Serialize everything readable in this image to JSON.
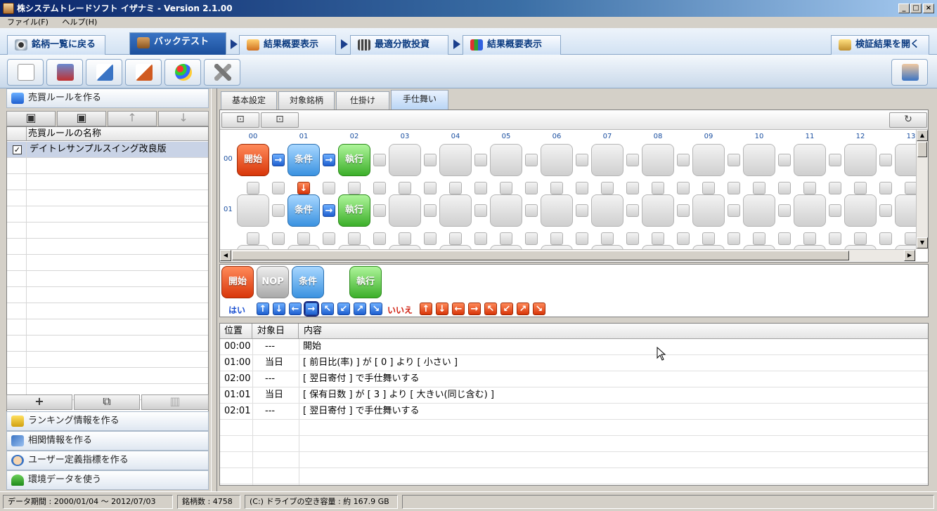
{
  "window": {
    "title": "株システムトレードソフト イザナミ - Version 2.1.00"
  },
  "menu": {
    "items": [
      "ファイル(F)",
      "ヘルプ(H)"
    ]
  },
  "main_tabs": {
    "stock_list": "銘柄一覧に戻る",
    "backtest": "バックテスト",
    "result_summary_1": "結果概要表示",
    "optimal_investment": "最適分散投資",
    "result_summary_2": "結果概要表示",
    "open_results": "検証結果を開く"
  },
  "left": {
    "rule_header": "売買ルールを作る",
    "list_column": "売買ルールの名称",
    "rules": [
      {
        "name": "デイトレサンプルスイング改良版",
        "checked": true
      }
    ],
    "ranking": "ランキング情報を作る",
    "correlation": "相関情報を作る",
    "user_indicator": "ユーザー定義指標を作る",
    "environment": "環境データを使う"
  },
  "sub_tabs": [
    "基本設定",
    "対象銘柄",
    "仕掛け",
    "手仕舞い"
  ],
  "flow": {
    "columns": [
      "00",
      "01",
      "02",
      "03",
      "04",
      "05",
      "06",
      "07",
      "08",
      "09",
      "10",
      "11",
      "12",
      "13"
    ],
    "rows": [
      "00",
      "01"
    ],
    "nodes": {
      "start": "開始",
      "cond": "条件",
      "exec": "執行"
    }
  },
  "palette": {
    "start": "開始",
    "nop": "NOP",
    "cond": "条件",
    "exec": "執行",
    "yes": "はい",
    "no": "いいえ"
  },
  "result_table": {
    "headers": [
      "位置",
      "対象日",
      "内容"
    ],
    "rows": [
      [
        "00:00",
        "---",
        "開始"
      ],
      [
        "01:00",
        "当日",
        "[ 前日比(率) ] が [ 0 ] より [ 小さい ]"
      ],
      [
        "02:00",
        "---",
        "[ 翌日寄付 ] で手仕舞いする"
      ],
      [
        "01:01",
        "当日",
        "[ 保有日数 ] が [ 3 ] より [ 大きい(同じ含む) ]"
      ],
      [
        "02:01",
        "---",
        "[ 翌日寄付 ] で手仕舞いする"
      ]
    ]
  },
  "status": {
    "period": "データ期間 : 2000/01/04 〜 2012/07/03",
    "count": "銘柄数 : 4758",
    "disk": "(C:) ドライブの空き容量 : 約 167.9 GB"
  }
}
